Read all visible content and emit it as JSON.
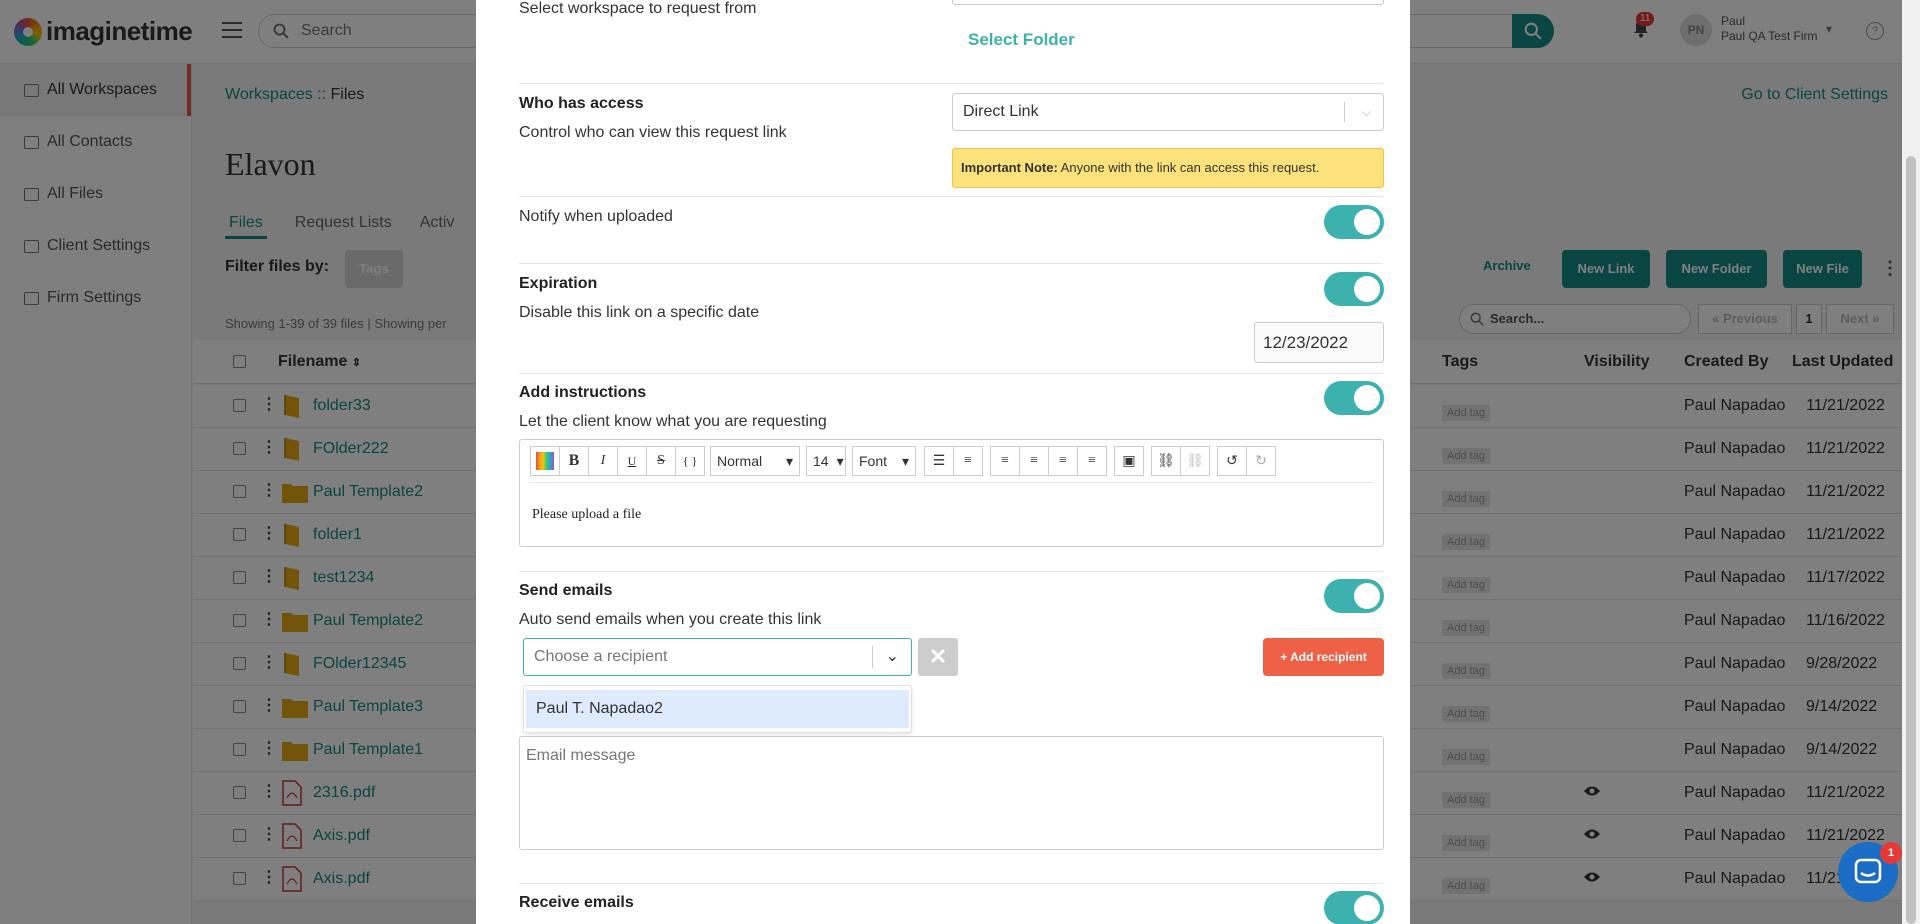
{
  "app": {
    "logo_text": "imaginetime",
    "search_placeholder": "Search",
    "notifications_count": "11",
    "user_initials": "PN",
    "user_name": "Paul",
    "firm_name": "Paul QA Test Firm"
  },
  "sidebar": {
    "items": [
      {
        "label": "All Workspaces",
        "icon": "workspaces-icon"
      },
      {
        "label": "All Contacts",
        "icon": "contacts-icon"
      },
      {
        "label": "All Files",
        "icon": "files-icon"
      },
      {
        "label": "Client Settings",
        "icon": "client-settings-icon"
      },
      {
        "label": "Firm Settings",
        "icon": "sliders-icon"
      }
    ]
  },
  "page": {
    "breadcrumb_root": "Workspaces",
    "breadcrumb_sep": " :: ",
    "breadcrumb_current": "Files",
    "client_settings_link": "Go to Client Settings",
    "title": "Elavon",
    "tabs": [
      "Files",
      "Request Lists",
      "Activ"
    ],
    "filter_label": "Filter files by:",
    "tags_button": "Tags",
    "showing": "Showing 1-39 of 39 files  |  Showing per",
    "archive_label": "Archive",
    "new_link": "New Link",
    "new_folder": "New Folder",
    "new_file": "New File",
    "files_search_placeholder": "Search...",
    "previous": "« Previous",
    "page_number": "1",
    "next": "Next »",
    "columns": {
      "filename": "Filename",
      "tags": "Tags",
      "visibility": "Visibility",
      "created_by": "Created By",
      "last_updated": "Last Updated"
    },
    "rows": [
      {
        "name": "folder33",
        "type": "folder-shared",
        "tag": "Add tag",
        "visible": false,
        "creator": "Paul Napadao",
        "updated": "11/21/2022"
      },
      {
        "name": "FOlder222",
        "type": "folder-shared",
        "tag": "Add tag",
        "visible": false,
        "creator": "Paul Napadao",
        "updated": "11/21/2022"
      },
      {
        "name": "Paul Template2",
        "type": "folder",
        "tag": "Add tag",
        "visible": false,
        "creator": "Paul Napadao",
        "updated": "11/21/2022"
      },
      {
        "name": "folder1",
        "type": "folder-shared",
        "tag": "Add tag",
        "visible": false,
        "creator": "Paul Napadao",
        "updated": "11/21/2022"
      },
      {
        "name": "test1234",
        "type": "folder-shared",
        "tag": "Add tag",
        "visible": false,
        "creator": "Paul Napadao",
        "updated": "11/17/2022"
      },
      {
        "name": "Paul Template2",
        "type": "folder",
        "tag": "Add tag",
        "visible": false,
        "creator": "Paul Napadao",
        "updated": "11/16/2022"
      },
      {
        "name": "FOlder12345",
        "type": "folder-shared",
        "tag": "Add tag",
        "visible": false,
        "creator": "Paul Napadao",
        "updated": "9/28/2022"
      },
      {
        "name": "Paul Template3",
        "type": "folder",
        "tag": "Add tag",
        "visible": false,
        "creator": "Paul Napadao",
        "updated": "9/14/2022"
      },
      {
        "name": "Paul Template1",
        "type": "folder",
        "tag": "Add tag",
        "visible": false,
        "creator": "Paul Napadao",
        "updated": "9/14/2022"
      },
      {
        "name": "2316.pdf",
        "type": "pdf",
        "tag": "Add tag",
        "visible": true,
        "creator": "Paul Napadao",
        "updated": "11/21/2022"
      },
      {
        "name": "Axis.pdf",
        "type": "pdf",
        "tag": "Add tag",
        "visible": true,
        "creator": "Paul Napadao",
        "updated": "11/21/2022"
      },
      {
        "name": "Axis.pdf",
        "type": "pdf",
        "tag": "Add tag",
        "visible": true,
        "creator": "Paul Napadao",
        "updated": "11/21/2022"
      }
    ]
  },
  "modal": {
    "workspace_label": "Select workspace to request from",
    "select_folder": "Select Folder",
    "access": {
      "title": "Who has access",
      "desc": "Control who can view this request link",
      "value": "Direct Link",
      "note_bold": "Important Note:",
      "note_text": " Anyone with the link can access this request."
    },
    "notify": {
      "title": "Notify when uploaded",
      "enabled": true
    },
    "expiration": {
      "title": "Expiration",
      "desc": "Disable this link on a specific date",
      "date": "12/23/2022",
      "enabled": true
    },
    "instructions": {
      "title": "Add instructions",
      "desc": "Let the client know what you are requesting",
      "enabled": true,
      "toolbar": {
        "style": "Normal",
        "size": "14",
        "font": "Font",
        "bold": "B",
        "italic": "I",
        "underline": "U",
        "strike": "S",
        "code": "{ }"
      },
      "body": "Please upload a file"
    },
    "send_emails": {
      "title": "Send emails",
      "desc": "Auto send emails when you create this link",
      "enabled": true,
      "recipient_placeholder": "Choose a recipient",
      "clear": "✕",
      "add_recipient": "+ Add recipient",
      "options": [
        "Paul T. Napadao2"
      ],
      "message_placeholder": "Email message"
    },
    "receive_emails": {
      "title": "Receive emails",
      "enabled": true
    }
  },
  "chat": {
    "badge": "1"
  },
  "colors": {
    "teal": "#138a85",
    "toggle": "#3db1ad",
    "accent_red": "#ee6146",
    "note_yellow": "#fde27c"
  }
}
